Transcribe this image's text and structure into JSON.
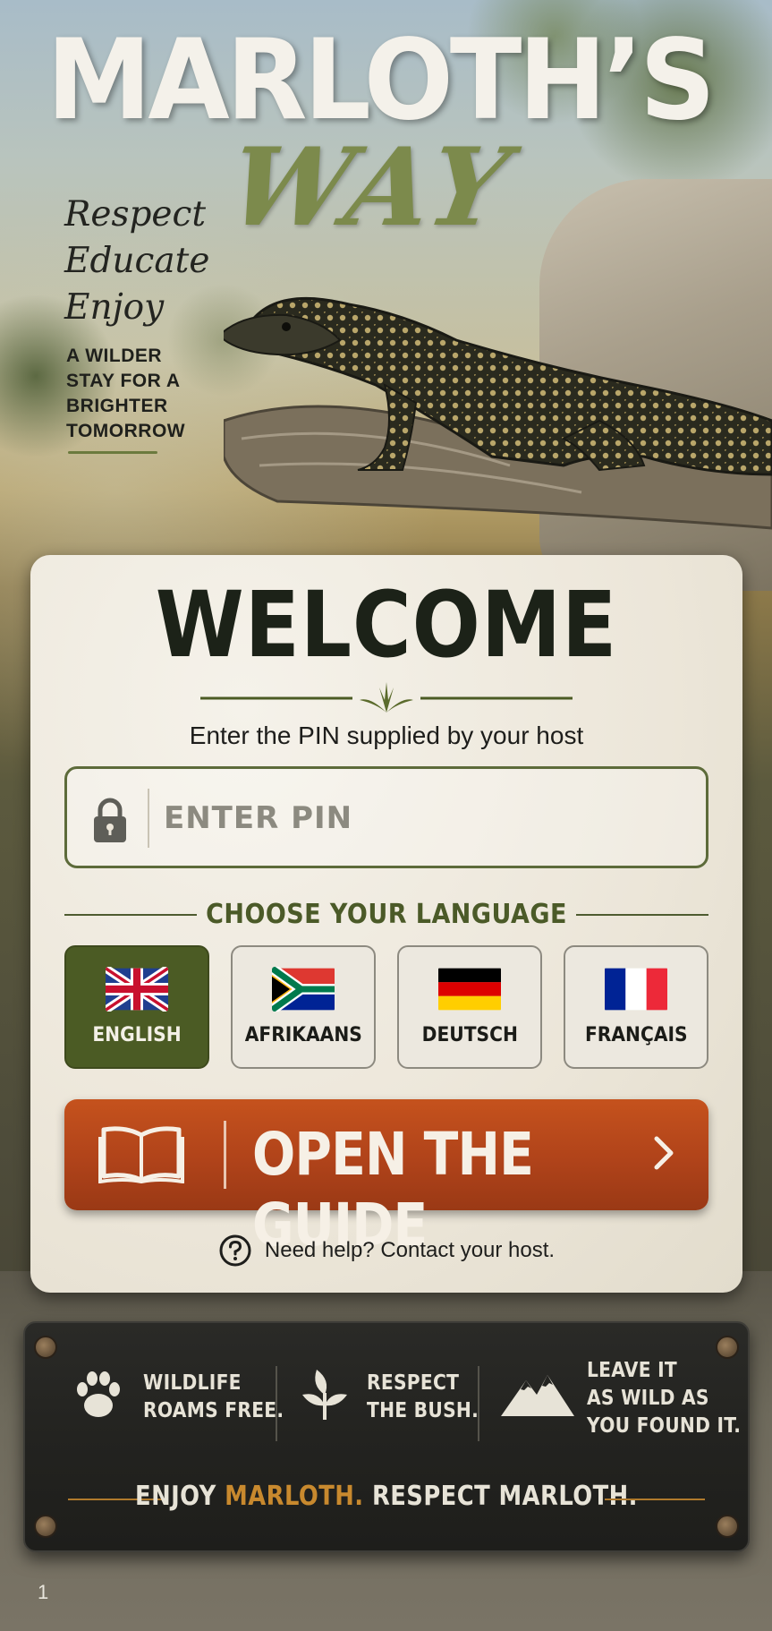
{
  "header": {
    "title_line1": "MARLOTH’S",
    "title_line2": "WAY",
    "motto": [
      "Respect",
      "Educate",
      "Enjoy"
    ],
    "tagline": [
      "A WILDER",
      "STAY FOR A",
      "BRIGHTER",
      "TOMORROW"
    ]
  },
  "card": {
    "heading": "WELCOME",
    "subtitle": "Enter the PIN supplied by your host",
    "pin": {
      "placeholder": "ENTER PIN",
      "value": "",
      "icon": "lock-icon"
    },
    "language_heading": "CHOOSE YOUR LANGUAGE",
    "languages": [
      {
        "label": "ENGLISH",
        "flag": "uk-flag-icon",
        "selected": true
      },
      {
        "label": "AFRIKAANS",
        "flag": "south-africa-flag-icon",
        "selected": false
      },
      {
        "label": "DEUTSCH",
        "flag": "germany-flag-icon",
        "selected": false
      },
      {
        "label": "FRANÇAIS",
        "flag": "france-flag-icon",
        "selected": false
      }
    ],
    "open_button": {
      "label": "OPEN THE GUIDE",
      "icon": "book-icon"
    },
    "help_text": "Need help? Contact your host."
  },
  "sign": {
    "items": [
      {
        "icon": "paw-icon",
        "lines": [
          "WILDLIFE",
          "ROAMS FREE."
        ]
      },
      {
        "icon": "leaf-icon",
        "lines": [
          "RESPECT",
          "THE BUSH."
        ]
      },
      {
        "icon": "mountain-icon",
        "lines": [
          "LEAVE IT",
          "AS WILD AS",
          "YOU FOUND IT."
        ]
      }
    ],
    "motto_part1": "ENJOY ",
    "motto_accent": "MARLOTH.",
    "motto_part2": " RESPECT MARLOTH."
  },
  "page_number": "1",
  "colors": {
    "brand_green": "#4b5b24",
    "title_green": "#7c8a4c",
    "cta_orange": "#b0431a",
    "accent_gold": "#c8892e",
    "card_bg": "#ece6d9",
    "sign_bg": "#232320"
  }
}
